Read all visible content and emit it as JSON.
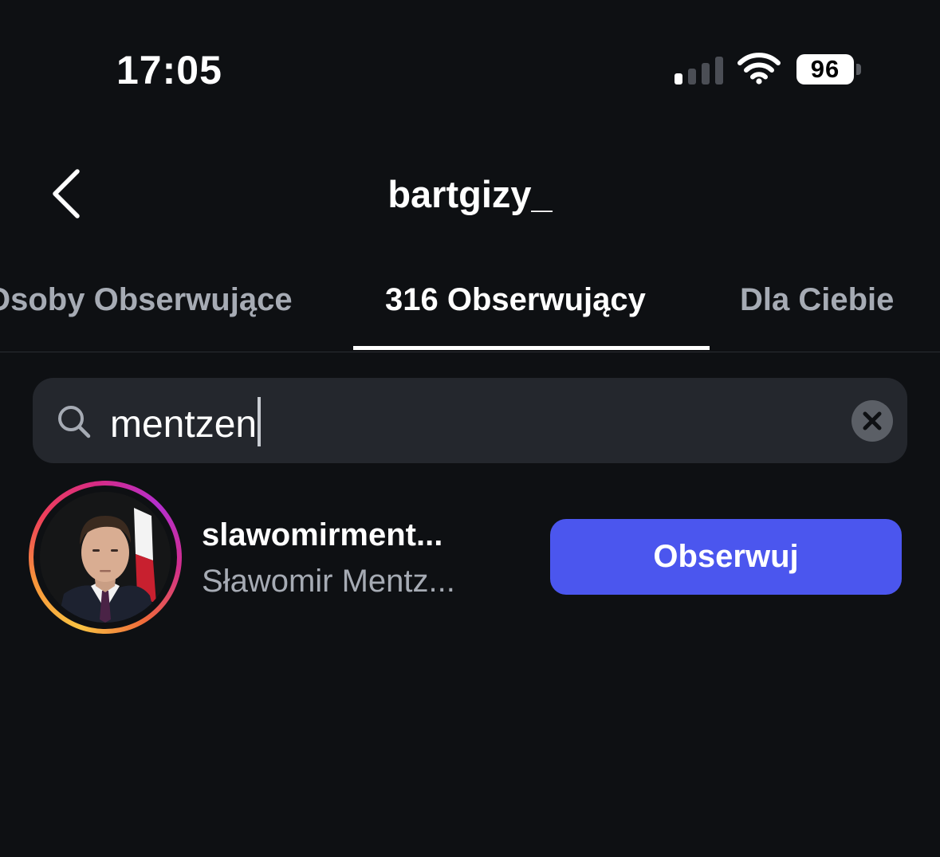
{
  "status_bar": {
    "time": "17:05",
    "battery": "96",
    "signal_bars_active": 1,
    "signal_bars_total": 4
  },
  "header": {
    "title": "bartgizy_",
    "back_icon": "chevron-left-icon"
  },
  "tabs": [
    {
      "label": "Osoby Obserwujące",
      "active": false
    },
    {
      "label": "316 Obserwujący",
      "active": true
    },
    {
      "label": "Dla Ciebie",
      "active": false
    }
  ],
  "search": {
    "value": "mentzen",
    "icon": "search-icon",
    "clear_icon": "close-icon"
  },
  "results": [
    {
      "username": "slawomirment...",
      "full_name": "Sławomir Mentz...",
      "follow_label": "Obserwuj"
    }
  ],
  "colors": {
    "background": "#0e1013",
    "search_bg": "#24272d",
    "secondary_text": "#a6abb4",
    "accent_button": "#4b56ee",
    "story_ring": [
      "#f9c343",
      "#ee3f5a",
      "#b52fcf"
    ]
  }
}
